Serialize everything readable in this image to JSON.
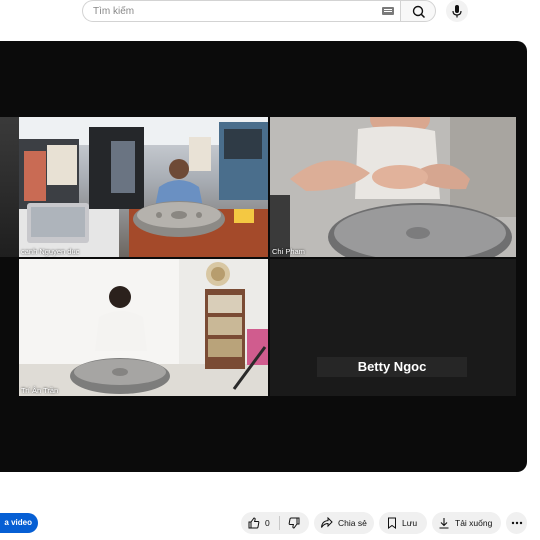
{
  "search": {
    "placeholder": "Tìm kiếm"
  },
  "participants": [
    {
      "name": "canh Nguyen duc"
    },
    {
      "name": "Chi Pham"
    },
    {
      "name": "Trí Ân Trần"
    },
    {
      "name": "Betty Ngoc"
    }
  ],
  "actions": {
    "like_count": "0",
    "share_label": "Chia sẻ",
    "save_label": "Lưu",
    "download_label": "Tải xuống",
    "partial_button_label": "a video"
  },
  "colors": {
    "accent": "#065fd4",
    "video_bg": "#0b0b0b",
    "pill_bg": "#f0f0f0"
  }
}
